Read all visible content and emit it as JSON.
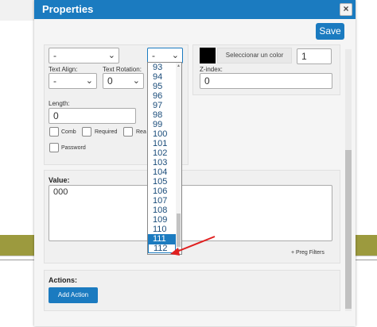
{
  "dialog": {
    "title": "Properties",
    "close_symbol": "×",
    "save_label": "Save"
  },
  "fields": {
    "font_select_value": "-",
    "size_select_value": "-",
    "color_button_label": "Seleccionar un color",
    "color_value": "#000000",
    "border_width_value": "1",
    "text_align_label": "Text Align:",
    "text_align_value": "-",
    "text_rotation_label": "Text Rotation:",
    "text_rotation_value": "0",
    "z_index_label": "Z-index:",
    "z_index_value": "0",
    "length_label": "Length:",
    "length_value": "0",
    "checkboxes": [
      {
        "label": "Comb"
      },
      {
        "label": "Required"
      },
      {
        "label": "Rea"
      },
      {
        "label": "Password"
      }
    ]
  },
  "value_section": {
    "label": "Value:",
    "text": "000",
    "preg_filters_label": "+ Preg Filters"
  },
  "actions_section": {
    "label": "Actions:",
    "add_action_label": "Add Action"
  },
  "dropdown": {
    "options": [
      "93",
      "94",
      "95",
      "96",
      "97",
      "98",
      "99",
      "100",
      "101",
      "102",
      "103",
      "104",
      "105",
      "106",
      "107",
      "108",
      "109",
      "110",
      "111",
      "112"
    ],
    "selected": "111",
    "hovered": "112"
  },
  "colors": {
    "accent": "#1b7bc0",
    "arrow": "#e02020"
  }
}
